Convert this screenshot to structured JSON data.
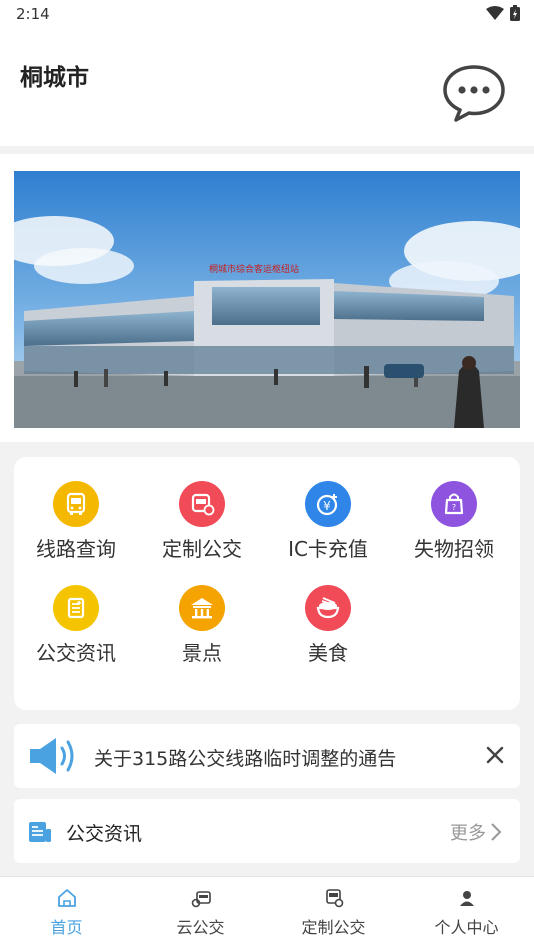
{
  "status_bar": {
    "time": "2:14",
    "icons": [
      "wifi-icon",
      "battery-icon"
    ]
  },
  "header": {
    "city": "桐城市",
    "message_icon": "chat-bubble-icon"
  },
  "banner": {
    "sign_text": "桐城市综合客运枢纽站"
  },
  "quick_menu": [
    {
      "label": "线路查询",
      "icon": "bus-route-icon",
      "color": "#f5b800"
    },
    {
      "label": "定制公交",
      "icon": "custom-bus-icon",
      "color": "#f04b56"
    },
    {
      "label": "IC卡充值",
      "icon": "yuan-recharge-icon",
      "color": "#2f86e8"
    },
    {
      "label": "失物招领",
      "icon": "lost-bag-icon",
      "color": "#8e54e0"
    },
    {
      "label": "公交资讯",
      "icon": "news-doc-icon",
      "color": "#f5c400"
    },
    {
      "label": "景点",
      "icon": "scenic-building-icon",
      "color": "#f5a300"
    },
    {
      "label": "美食",
      "icon": "food-bowl-icon",
      "color": "#f04b56"
    }
  ],
  "notice": {
    "text": "关于315路公交线路临时调整的通告",
    "icon": "speaker-icon"
  },
  "news": {
    "title": "公交资讯",
    "more": "更多",
    "icon": "newspaper-icon"
  },
  "tabbar": [
    {
      "label": "首页",
      "icon": "home-icon",
      "active": true
    },
    {
      "label": "云公交",
      "icon": "cloud-bus-icon",
      "active": false
    },
    {
      "label": "定制公交",
      "icon": "custom-bus-icon",
      "active": false
    },
    {
      "label": "个人中心",
      "icon": "person-icon",
      "active": false
    }
  ],
  "colors": {
    "accent": "#4aa3e0",
    "notice_icon": "#4aa3e0"
  }
}
